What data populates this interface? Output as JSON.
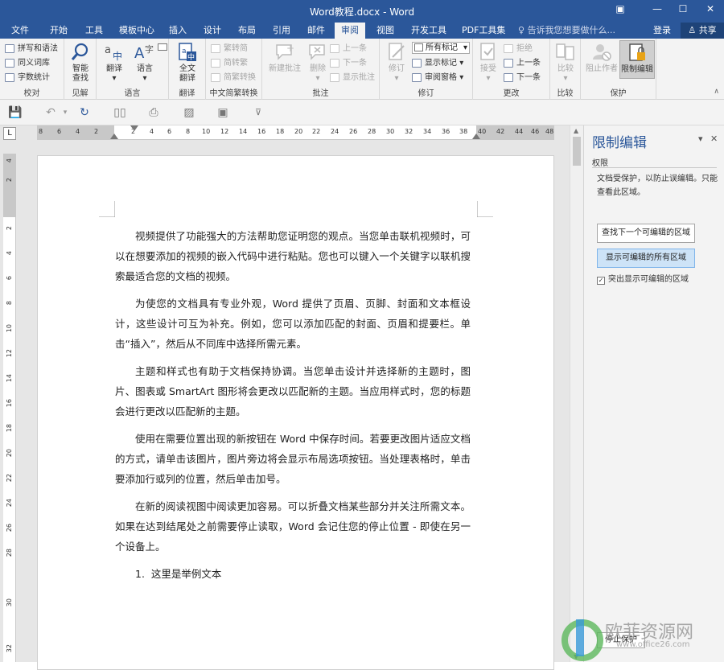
{
  "titlebar": {
    "title": "Word教程.docx - Word"
  },
  "tabs": [
    "文件",
    "开始",
    "工具",
    "模板中心",
    "插入",
    "设计",
    "布局",
    "引用",
    "邮件",
    "审阅",
    "视图",
    "开发工具",
    "PDF工具集"
  ],
  "active_tab": "审阅",
  "tellme": "告诉我您想要做什么...",
  "login": "登录",
  "share": "共享",
  "ribbon": {
    "proofing": {
      "spell": "拼写和语法",
      "thesaurus": "同义词库",
      "wordcount": "字数统计",
      "label": "校对"
    },
    "insights": {
      "smart_lookup": "智能\n查找",
      "label": "见解"
    },
    "language": {
      "translate": "翻译",
      "language": "语言",
      "label": "语言"
    },
    "fulltranslate": {
      "btn": "全文\n翻译",
      "label": "翻译"
    },
    "chinese": {
      "t2s": "繁转简",
      "s2t": "简转繁",
      "convert": "简繁转换",
      "label": "中文简繁转换"
    },
    "comments": {
      "new": "新建批注",
      "delete": "删除",
      "prev": "上一条",
      "next": "下一条",
      "show": "显示批注",
      "label": "批注"
    },
    "tracking": {
      "track": "修订",
      "markup_select": "所有标记",
      "show_markup": "显示标记",
      "review_pane": "审阅窗格",
      "label": "修订"
    },
    "changes": {
      "accept": "接受",
      "reject": "拒绝",
      "prev": "上一条",
      "next": "下一条",
      "label": "更改"
    },
    "compare": {
      "btn": "比较",
      "label": "比较"
    },
    "protect": {
      "block": "阻止作者",
      "restrict": "限制编辑",
      "label": "保护"
    }
  },
  "ruler": {
    "h_labels": [
      "8",
      "6",
      "4",
      "2",
      "2",
      "4",
      "6",
      "8",
      "10",
      "12",
      "14",
      "16",
      "18",
      "20",
      "22",
      "24",
      "26",
      "28",
      "30",
      "32",
      "34",
      "36",
      "38",
      "40",
      "42",
      "44",
      "46",
      "48"
    ],
    "v_labels": [
      "4",
      "2",
      "2",
      "4",
      "6",
      "8",
      "10",
      "12",
      "14",
      "16",
      "18",
      "20",
      "22",
      "24",
      "26",
      "28",
      "30",
      "32"
    ],
    "tab_selector": "L"
  },
  "document": {
    "paragraphs": [
      "视频提供了功能强大的方法帮助您证明您的观点。当您单击联机视频时，可以在想要添加的视频的嵌入代码中进行粘贴。您也可以键入一个关键字以联机搜索最适合您的文档的视频。",
      "为使您的文档具有专业外观，Word 提供了页眉、页脚、封面和文本框设计，这些设计可互为补充。例如，您可以添加匹配的封面、页眉和提要栏。单击“插入”，然后从不同库中选择所需元素。",
      "主题和样式也有助于文档保持协调。当您单击设计并选择新的主题时，图片、图表或 SmartArt 图形将会更改以匹配新的主题。当应用样式时，您的标题会进行更改以匹配新的主题。",
      "使用在需要位置出现的新按钮在 Word 中保存时间。若要更改图片适应文档的方式，请单击该图片，图片旁边将会显示布局选项按钮。当处理表格时，单击要添加行或列的位置，然后单击加号。",
      "在新的阅读视图中阅读更加容易。可以折叠文档某些部分并关注所需文本。如果在达到结尾处之前需要停止读取，Word 会记住您的停止位置 - 即使在另一个设备上。"
    ],
    "list_item": "1.  这里是举例文本"
  },
  "pane": {
    "title": "限制编辑",
    "subtitle": "权限",
    "desc": "文档受保护，以防止误编辑。只能查看此区域。",
    "find_next": "查找下一个可编辑的区域",
    "show_all": "显示可编辑的所有区域",
    "highlight": "突出显示可编辑的区域",
    "highlight_checked": true,
    "stop": "停止保护"
  },
  "watermark": {
    "brand": "欧菲资源网",
    "url": "www.office26.com"
  },
  "colors": {
    "accent": "#2b579a",
    "ribbon_bg": "#f3f3f3",
    "doc_bg": "#e6e6e6"
  }
}
